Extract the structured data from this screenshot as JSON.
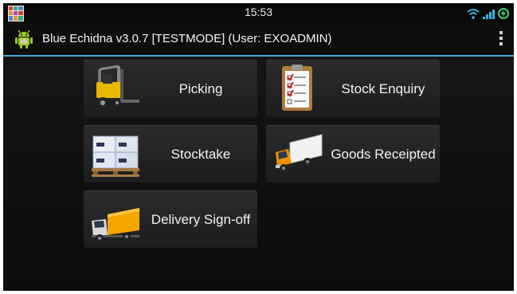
{
  "status_bar": {
    "time": "15:53",
    "icons": [
      "app-notification-icon",
      "wifi-icon",
      "signal-icon",
      "charging-icon"
    ]
  },
  "action_bar": {
    "title": "Blue Echidna v3.0.7 [TESTMODE] (User: EXOADMIN)",
    "app_icon": "android-robot-icon",
    "menu_icon": "overflow-menu-icon"
  },
  "menu": {
    "picking": {
      "label": "Picking",
      "icon": "forklift-icon"
    },
    "stock_enquiry": {
      "label": "Stock Enquiry",
      "icon": "clipboard-checklist-icon"
    },
    "stocktake": {
      "label": "Stocktake",
      "icon": "pallet-boxes-icon"
    },
    "goods_receipted": {
      "label": "Goods Receipted",
      "icon": "truck-icon"
    },
    "delivery_signoff": {
      "label": "Delivery Sign-off",
      "icon": "delivery-truck-icon"
    }
  },
  "colors": {
    "accent": "#3fa9d8",
    "background": "#0c0c0c",
    "tile": "#262626",
    "text": "#f2f2f2"
  }
}
